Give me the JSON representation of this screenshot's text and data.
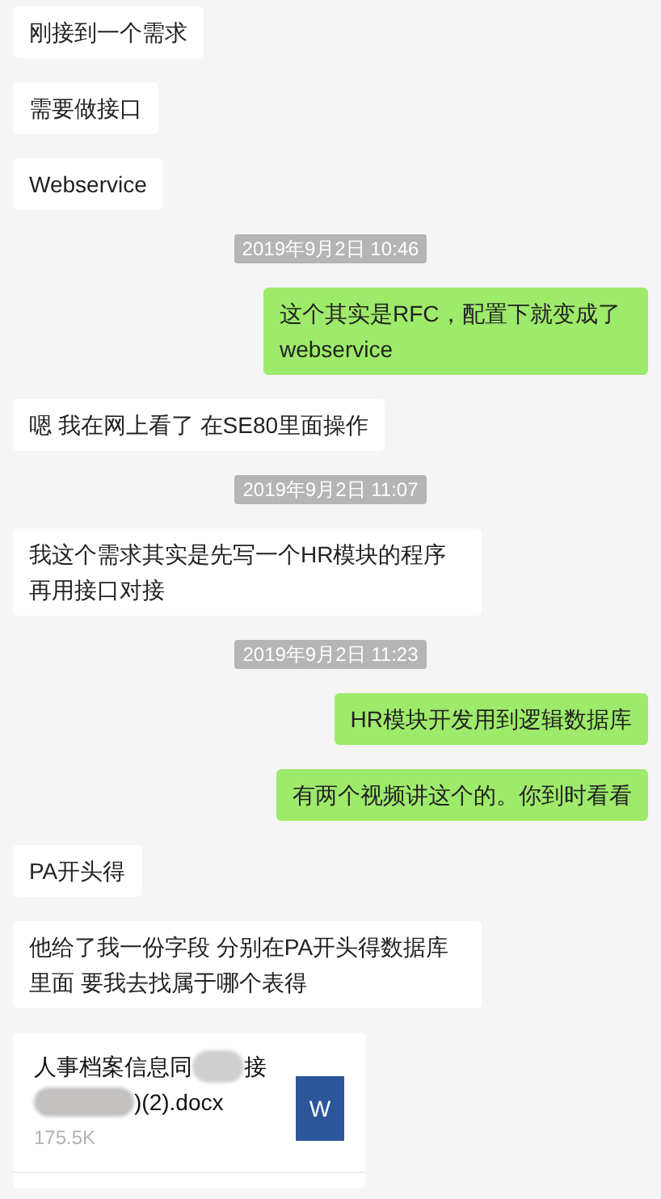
{
  "messages": [
    {
      "kind": "text",
      "sent": false,
      "text": "刚接到一个需求"
    },
    {
      "kind": "text",
      "sent": false,
      "text": "需要做接口"
    },
    {
      "kind": "text",
      "sent": false,
      "text": "Webservice"
    },
    {
      "kind": "time",
      "text": "2019年9月2日 10:46"
    },
    {
      "kind": "text",
      "sent": true,
      "text": "这个其实是RFC，配置下就变成了webservice"
    },
    {
      "kind": "text",
      "sent": false,
      "text": "嗯 我在网上看了  在SE80里面操作"
    },
    {
      "kind": "time",
      "text": "2019年9月2日 11:07"
    },
    {
      "kind": "text",
      "sent": false,
      "text": "我这个需求其实是先写一个HR模块的程序再用接口对接"
    },
    {
      "kind": "time",
      "text": "2019年9月2日 11:23"
    },
    {
      "kind": "text",
      "sent": true,
      "text": "HR模块开发用到逻辑数据库"
    },
    {
      "kind": "text",
      "sent": true,
      "text": "有两个视频讲这个的。你到时看看"
    },
    {
      "kind": "text",
      "sent": false,
      "text": "PA开头得"
    },
    {
      "kind": "text",
      "sent": false,
      "text": "他给了我一份字段 分别在PA开头得数据库里面  要我去找属于哪个表得"
    },
    {
      "kind": "file",
      "name_start": "人事档案信息同",
      "name_mid": "接",
      "name_end": ")(2).docx",
      "size": "175.5K",
      "icon_letter": "W"
    }
  ]
}
